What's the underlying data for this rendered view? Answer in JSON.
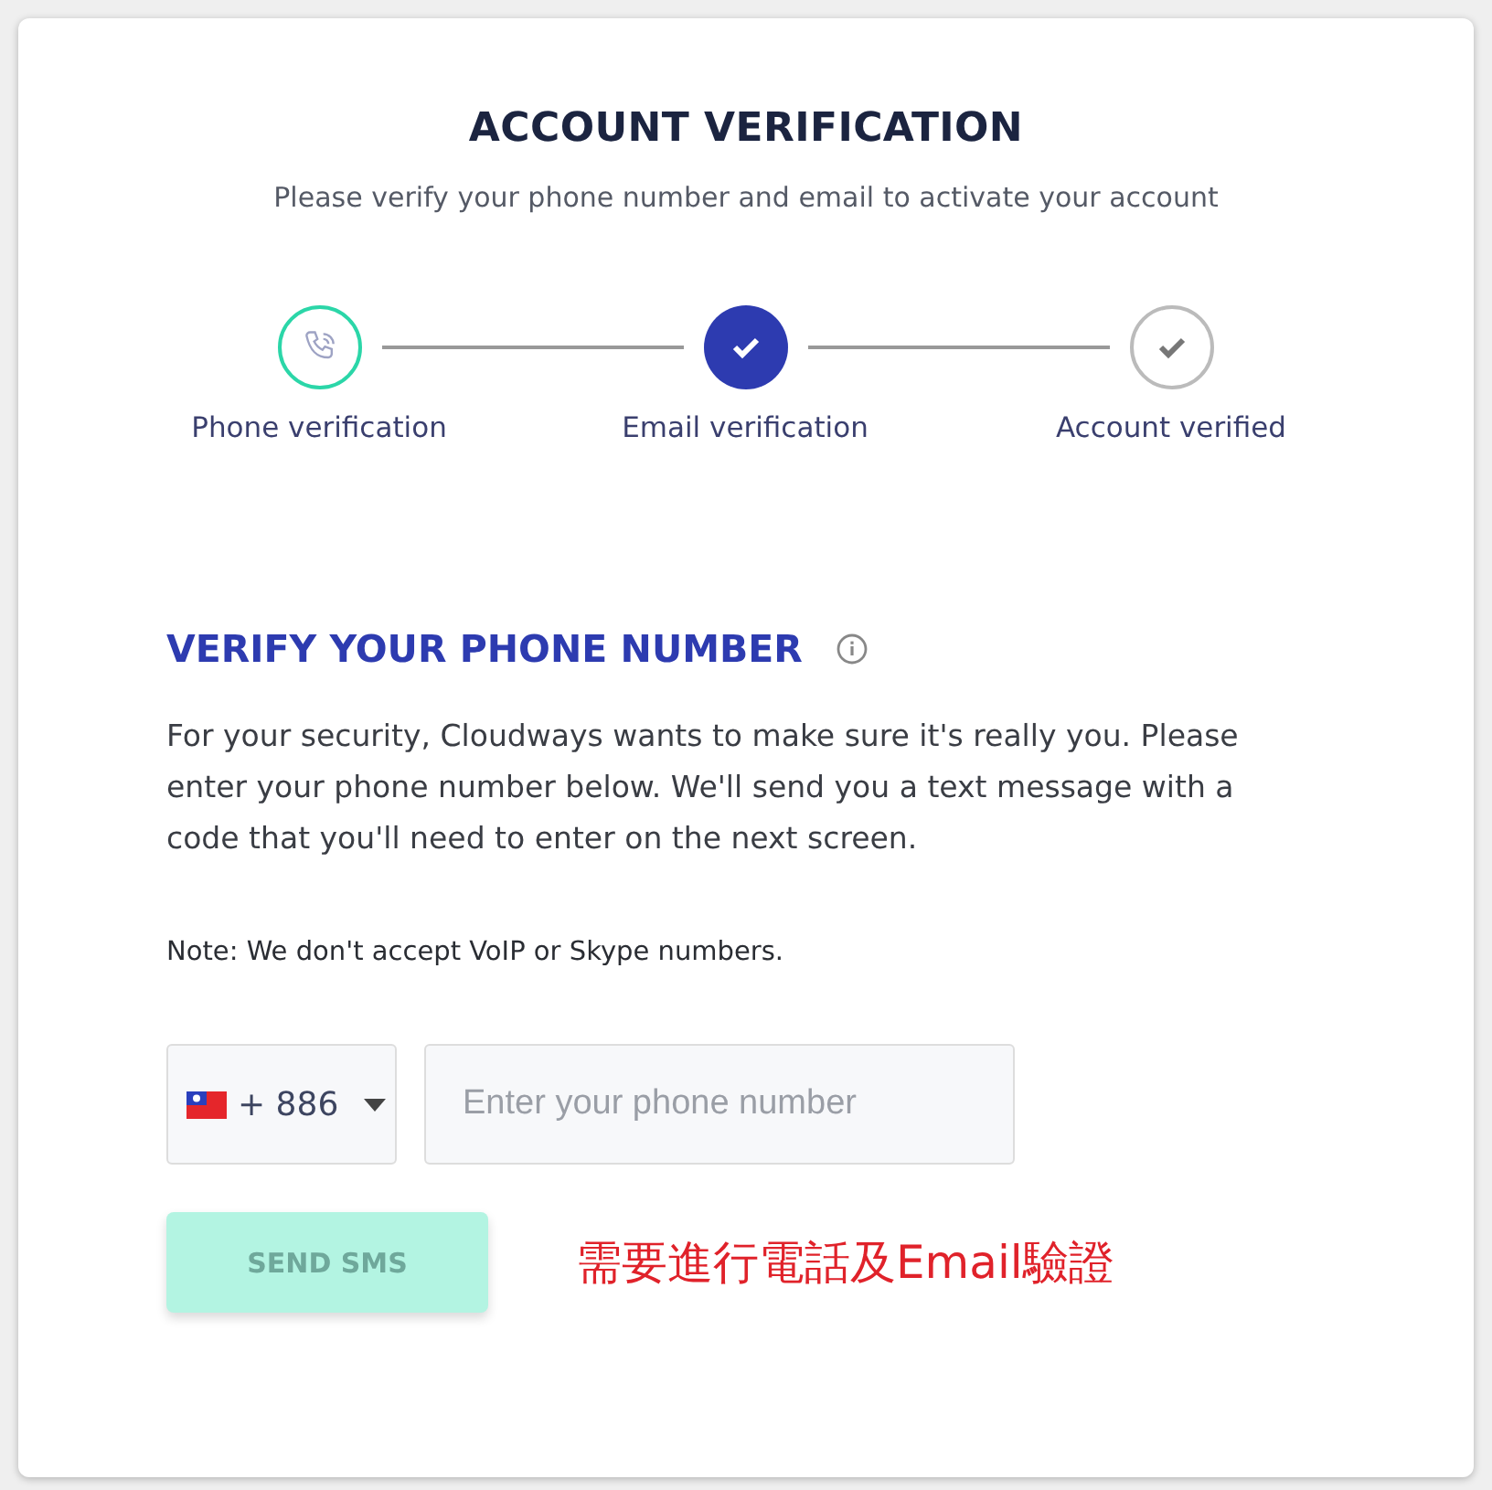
{
  "title": "ACCOUNT VERIFICATION",
  "subtitle": "Please verify your phone number and email to activate your account",
  "steps": [
    {
      "label": "Phone verification",
      "kind": "current"
    },
    {
      "label": "Email verification",
      "kind": "done"
    },
    {
      "label": "Account verified",
      "kind": "pending"
    }
  ],
  "section": {
    "heading": "VERIFY YOUR PHONE NUMBER",
    "text": "For your security, Cloudways wants to make sure it's really you. Please enter your phone number below. We'll send you a text message with a code that you'll need to enter on the next screen.",
    "note": "Note: We don't accept VoIP or Skype numbers."
  },
  "country_code": {
    "value": "+ 886"
  },
  "phone": {
    "placeholder": "Enter your phone number"
  },
  "send_button": {
    "label": "SEND SMS",
    "disabled": true
  },
  "annotation": "需要進行電話及Email驗證"
}
